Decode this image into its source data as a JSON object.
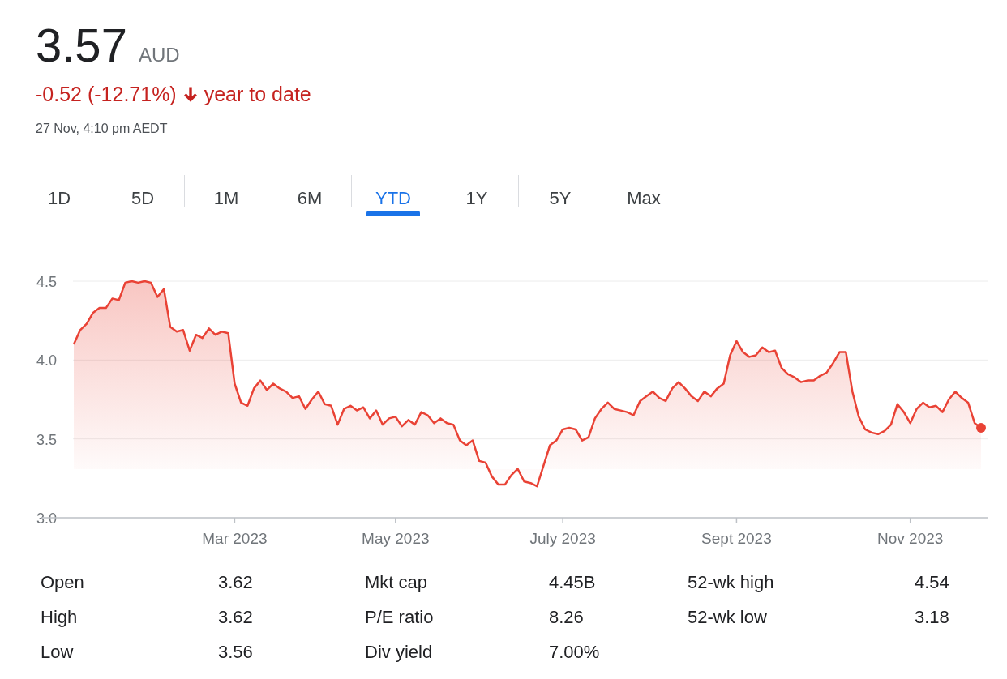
{
  "quote": {
    "price": "3.57",
    "currency": "AUD",
    "change": "-0.52 (-12.71%)",
    "period": "year to date",
    "timestamp": "27 Nov, 4:10 pm AEDT"
  },
  "ranges": [
    {
      "label": "1D",
      "selected": false
    },
    {
      "label": "5D",
      "selected": false
    },
    {
      "label": "1M",
      "selected": false
    },
    {
      "label": "6M",
      "selected": false
    },
    {
      "label": "YTD",
      "selected": true
    },
    {
      "label": "1Y",
      "selected": false
    },
    {
      "label": "5Y",
      "selected": false
    },
    {
      "label": "Max",
      "selected": false
    }
  ],
  "chart": {
    "chart_data": {
      "type": "line",
      "ylim": [
        3.0,
        4.5
      ],
      "grid": true,
      "yticks": [
        {
          "value": 3.0,
          "label": "3.0"
        },
        {
          "value": 3.5,
          "label": "3.5"
        },
        {
          "value": 4.0,
          "label": "4.0"
        },
        {
          "value": 4.5,
          "label": "4.5"
        }
      ],
      "categories": [
        null,
        null,
        null,
        null,
        null,
        null,
        null,
        null,
        null,
        null,
        null,
        null,
        null,
        null,
        null,
        null,
        null,
        null,
        null,
        null,
        null,
        null,
        null,
        null,
        null,
        "Mar 2023",
        null,
        null,
        null,
        null,
        null,
        null,
        null,
        null,
        null,
        null,
        null,
        null,
        null,
        null,
        null,
        null,
        null,
        null,
        null,
        null,
        null,
        null,
        null,
        null,
        "May 2023",
        null,
        null,
        null,
        null,
        null,
        null,
        null,
        null,
        null,
        null,
        null,
        null,
        null,
        null,
        null,
        null,
        null,
        null,
        null,
        null,
        null,
        null,
        null,
        null,
        null,
        "July 2023",
        null,
        null,
        null,
        null,
        null,
        null,
        null,
        null,
        null,
        null,
        null,
        null,
        null,
        null,
        null,
        null,
        null,
        null,
        null,
        null,
        null,
        null,
        null,
        null,
        null,
        null,
        "Sept 2023",
        null,
        null,
        null,
        null,
        null,
        null,
        null,
        null,
        null,
        null,
        null,
        null,
        null,
        null,
        null,
        null,
        null,
        null,
        null,
        null,
        null,
        null,
        null,
        null,
        null,
        null,
        "Nov 2023",
        null,
        null,
        null,
        null,
        null,
        null,
        null,
        null,
        null,
        null,
        null
      ],
      "series": [
        {
          "color": "#e94235",
          "values": [
            4.1,
            4.19,
            4.23,
            4.3,
            4.33,
            4.33,
            4.39,
            4.38,
            4.49,
            4.5,
            4.49,
            4.5,
            4.49,
            4.4,
            4.45,
            4.21,
            4.18,
            4.19,
            4.06,
            4.16,
            4.14,
            4.2,
            4.16,
            4.18,
            4.17,
            3.85,
            3.73,
            3.71,
            3.82,
            3.87,
            3.81,
            3.85,
            3.82,
            3.8,
            3.76,
            3.77,
            3.69,
            3.75,
            3.8,
            3.72,
            3.71,
            3.59,
            3.69,
            3.71,
            3.68,
            3.7,
            3.63,
            3.68,
            3.59,
            3.63,
            3.64,
            3.58,
            3.62,
            3.59,
            3.67,
            3.65,
            3.6,
            3.63,
            3.6,
            3.59,
            3.49,
            3.46,
            3.49,
            3.36,
            3.35,
            3.26,
            3.21,
            3.21,
            3.27,
            3.31,
            3.23,
            3.22,
            3.2,
            3.33,
            3.46,
            3.49,
            3.56,
            3.57,
            3.56,
            3.49,
            3.51,
            3.63,
            3.69,
            3.73,
            3.69,
            3.68,
            3.67,
            3.65,
            3.74,
            3.77,
            3.8,
            3.76,
            3.74,
            3.82,
            3.86,
            3.82,
            3.77,
            3.74,
            3.8,
            3.77,
            3.82,
            3.85,
            4.03,
            4.12,
            4.05,
            4.02,
            4.03,
            4.08,
            4.05,
            4.06,
            3.95,
            3.91,
            3.89,
            3.86,
            3.87,
            3.87,
            3.9,
            3.92,
            3.98,
            4.05,
            4.05,
            3.8,
            3.64,
            3.56,
            3.54,
            3.53,
            3.55,
            3.59,
            3.72,
            3.67,
            3.6,
            3.69,
            3.73,
            3.7,
            3.71,
            3.67,
            3.75,
            3.8,
            3.76,
            3.73,
            3.6,
            3.57
          ]
        }
      ]
    }
  },
  "stats": [
    [
      {
        "label": "Open",
        "value": "3.62"
      },
      {
        "label": "High",
        "value": "3.62"
      },
      {
        "label": "Low",
        "value": "3.56"
      }
    ],
    [
      {
        "label": "Mkt cap",
        "value": "4.45B"
      },
      {
        "label": "P/E ratio",
        "value": "8.26"
      },
      {
        "label": "Div yield",
        "value": "7.00%"
      }
    ],
    [
      {
        "label": "52-wk high",
        "value": "4.54"
      },
      {
        "label": "52-wk low",
        "value": "3.18"
      }
    ]
  ]
}
